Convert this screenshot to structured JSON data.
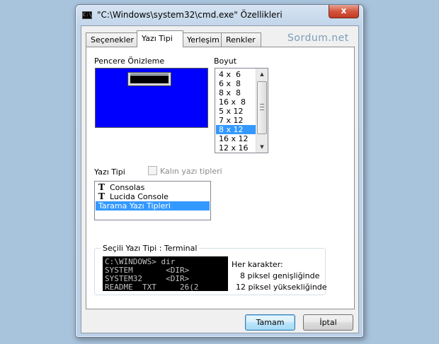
{
  "window": {
    "title": "\"C:\\Windows\\system32\\cmd.exe\" Özellikleri",
    "icon": "C:\\",
    "close": "x"
  },
  "tabs": [
    "Seçenekler",
    "Yazı Tipi",
    "Yerleşim",
    "Renkler"
  ],
  "active_tab": "Yazı Tipi",
  "watermark": "Sordum.net",
  "preview": {
    "label": "Pencere Önizleme"
  },
  "size": {
    "label": "Boyut",
    "items": [
      "4 x  6",
      "6 x  8",
      "8 x  8",
      "16 x  8",
      "5 x 12",
      "7 x 12",
      "8 x 12",
      "16 x 12",
      "12 x 16"
    ],
    "selected": "8 x 12"
  },
  "font": {
    "label": "Yazı Tipi",
    "bold_checkbox_label": "Kalın yazı tipleri",
    "bold_checked": false,
    "items": [
      "Consolas",
      "Lucida Console",
      "Tarama Yazı Tipleri"
    ],
    "selected": "Tarama Yazı Tipleri"
  },
  "selected_font": {
    "title": "Seçili Yazı Tipi : Terminal",
    "sample_lines": [
      "C:\\WINDOWS> dir",
      "SYSTEM       <DIR>",
      "SYSTEM32     <DIR>",
      "README  TXT     26(2"
    ],
    "char_heading": "Her karakter:",
    "width_text": "8 piksel genişliğinde",
    "height_text": "12 piksel yüksekliğinde"
  },
  "buttons": {
    "ok": "Tamam",
    "cancel": "İptal"
  },
  "colors": {
    "preview_bg": "#0000ff",
    "selection": "#3399ff"
  }
}
